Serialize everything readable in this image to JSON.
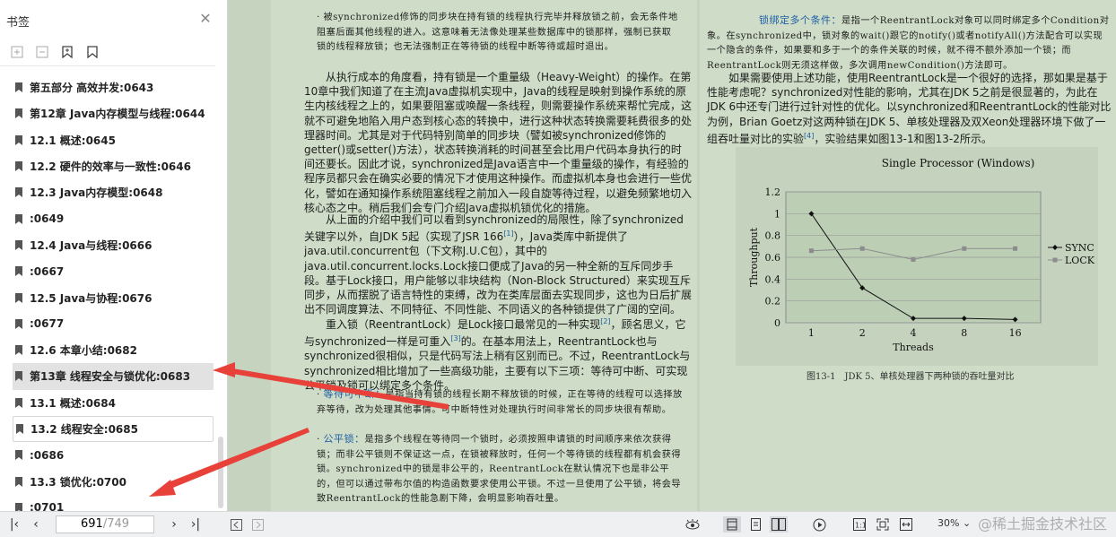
{
  "sidebar": {
    "title": "书签",
    "items": [
      {
        "label": "第五部分 高效并发:0643"
      },
      {
        "label": "第12章 Java内存模型与线程:0644"
      },
      {
        "label": "12.1 概述:0645"
      },
      {
        "label": "12.2 硬件的效率与一致性:0646"
      },
      {
        "label": "12.3 Java内存模型:0648"
      },
      {
        "label": ":0649"
      },
      {
        "label": "12.4 Java与线程:0666"
      },
      {
        "label": ":0667"
      },
      {
        "label": "12.5 Java与协程:0676"
      },
      {
        "label": ":0677"
      },
      {
        "label": "12.6 本章小结:0682"
      },
      {
        "label": "第13章 线程安全与锁优化:0683"
      },
      {
        "label": "13.1 概述:0684"
      },
      {
        "label": "13.2 线程安全:0685"
      },
      {
        "label": ":0686"
      },
      {
        "label": "13.3 锁优化:0700"
      },
      {
        "label": ":0701"
      }
    ]
  },
  "left_page": {
    "p1": "· 被synchronized修饰的同步块在持有锁的线程执行完毕并释放锁之前，会无条件地阻塞后面其他线程的进入。这意味着无法像处理某些数据库中的锁那样，强制已获取锁的线程释放锁；也无法强制正在等待锁的线程中断等待或超时退出。",
    "p2": "从执行成本的角度看，持有锁是一个重量级（Heavy-Weight）的操作。在第10章中我们知道了在主流Java虚拟机实现中，Java的线程是映射到操作系统的原生内核线程之上的，如果要阻塞或唤醒一条线程，则需要操作系统来帮忙完成，这就不可避免地陷入用户态到核心态的转换中，进行这种状态转换需要耗费很多的处理器时间。尤其是对于代码特别简单的同步块（譬如被synchronized修饰的getter()或setter()方法），状态转换消耗的时间甚至会比用户代码本身执行的时间还要长。因此才说，synchronized是Java语言中一个重量级的操作，有经验的程序员都只会在确实必要的情况下才使用这种操作。而虚拟机本身也会进行一些优化，譬如在通知操作系统阻塞线程之前加入一段自旋等待过程，以避免频繁地切入核心态之中。稍后我们会专门介绍Java虚拟机锁优化的措施。",
    "p3a": "从上面的介绍中我们可以看到synchronized的局限性，除了synchronized关键字以外，自JDK 5起（实现了JSR 166",
    "p3_ref": "[1]",
    "p3b": "），Java类库中新提供了java.util.concurrent包（下文称J.U.C包），其中的java.util.concurrent.locks.Lock接口便成了Java的另一种全新的互斥同步手段。基于Lock接口，用户能够以非块结构（Non-Block Structured）来实现互斥同步，从而摆脱了语言特性的束缚，改为在类库层面去实现同步，这也为日后扩展出不同调度算法、不同特征、不同性能、不同语义的各种锁提供了广阔的空间。",
    "p4a": "重入锁（ReentrantLock）是Lock接口最常见的一种实现",
    "p4_ref1": "[2]",
    "p4b": "，顾名思义，它与synchronized一样是可重入",
    "p4_ref2": "[3]",
    "p4c": "的。在基本用法上，ReentrantLock也与synchronized很相似，只是代码写法上稍有区别而已。不过，ReentrantLock与synchronized相比增加了一些高级功能，主要有以下三项：等待可中断、可实现公平锁及锁可以绑定多个条件。",
    "b1_title": "等待可中断：",
    "b1_text": "是指当持有锁的线程长期不释放锁的时候，正在等待的线程可以选择放弃等待，改为处理其他事情。可中断特性对处理执行时间非常长的同步块很有帮助。",
    "b2_title": "公平锁：",
    "b2_text": "是指多个线程在等待同一个锁时，必须按照申请锁的时间顺序来依次获得锁；而非公平锁则不保证这一点，在锁被释放时，任何一个等待锁的线程都有机会获得锁。synchronized中的锁是非公平的，ReentrantLock在默认情况下也是非公平的，但可以通过带布尔值的构造函数要求使用公平锁。不过一旦使用了公平锁，将会导致ReentrantLock的性能急剧下降，会明显影响吞吐量。"
  },
  "right_page": {
    "b3_title": "锁绑定多个条件：",
    "b3_text": "是指一个ReentrantLock对象可以同时绑定多个Condition对象。在synchronized中，锁对象的wait()跟它的notify()或者notifyAll()方法配合可以实现一个隐含的条件，如果要和多于一个的条件关联的时候，就不得不额外添加一个锁；而ReentrantLock则无须这样做，多次调用newCondition()方法即可。",
    "p5a": "如果需要使用上述功能，使用ReentrantLock是一个很好的选择，那如果是基于性能考虑呢？synchronized对性能的影响，尤其在JDK 5之前是很显著的，为此在JDK 6中还专门进行过针对性的优化。以synchronized和ReentrantLock的性能对比为例，Brian Goetz对这两种锁在JDK 5、单核处理器及双Xeon处理器环境下做了一组吞吐量对比的实验",
    "p5_ref": "[4]",
    "p5b": "，实验结果如图13-1和图13-2所示。",
    "figure_caption": "图13-1　JDK 5、单核处理器下两种锁的吞吐量对比"
  },
  "chart_data": {
    "type": "line",
    "title": "Single Processor (Windows)",
    "xlabel": "Threads",
    "ylabel": "Throughput",
    "categories": [
      "1",
      "2",
      "4",
      "8",
      "16"
    ],
    "ylim": [
      0,
      1.2
    ],
    "yticks": [
      "0",
      "0.2",
      "0.4",
      "0.6",
      "0.8",
      "1",
      "1.2"
    ],
    "grid": true,
    "legend_position": "right",
    "series": [
      {
        "name": "SYNC",
        "values": [
          1.0,
          0.32,
          0.04,
          0.04,
          0.03
        ],
        "color": "#111111",
        "marker": "diamond"
      },
      {
        "name": "LOCK",
        "values": [
          0.66,
          0.68,
          0.58,
          0.68,
          0.68
        ],
        "color": "#8c8c8c",
        "marker": "square"
      }
    ]
  },
  "bottom_bar": {
    "page_current": "691",
    "page_total": "/749",
    "zoom": "30%"
  },
  "watermark": "@稀土掘金技术社区",
  "colors": {
    "arrow": "#e8413a",
    "page_bg": "#cfddc8",
    "link_blue": "#1d5fa3"
  }
}
